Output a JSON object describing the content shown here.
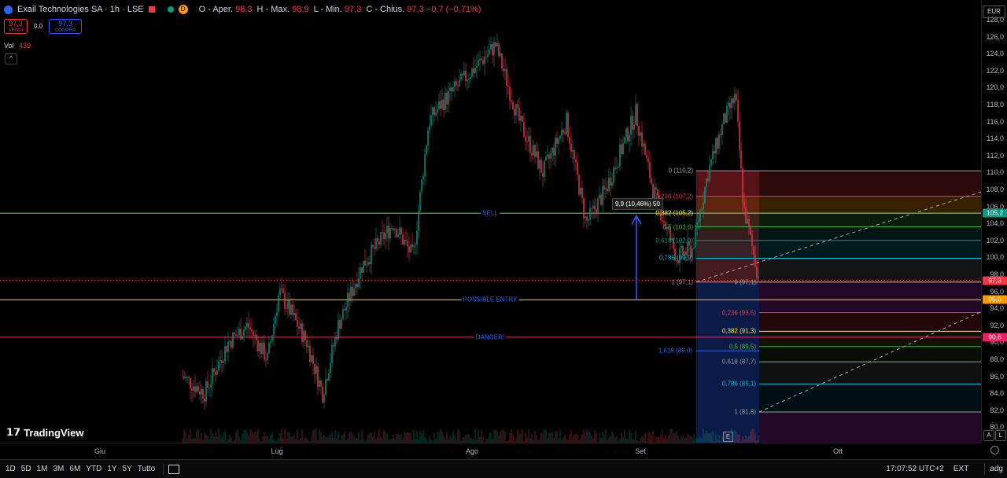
{
  "header": {
    "title": "Exail Technologies SA · 1h · LSE",
    "status_letter": "D",
    "ohlc": {
      "open_label": "O - Aper.",
      "open": "98,3",
      "high_label": "H - Max.",
      "high": "98,9",
      "low_label": "L - Min.",
      "low": "97,3",
      "close_label": "C - Chius.",
      "close": "97,3",
      "change": "−0,7 (−0,71%)"
    }
  },
  "trade": {
    "sell_price": "97,3",
    "sell_label": "VENDI",
    "spread": "0,0",
    "buy_price": "97,3",
    "buy_label": "COMPRA"
  },
  "volume": {
    "label": "Vol",
    "value": "439"
  },
  "collapse_icon": "^",
  "currency": "EUR",
  "price_axis": {
    "ticks": [
      "128,0",
      "126,0",
      "124,0",
      "122,0",
      "120,0",
      "118,0",
      "116,0",
      "114,0",
      "112,0",
      "110,0",
      "108,0",
      "106,0",
      "104,0",
      "102,0",
      "100,0",
      "98,0",
      "96,0",
      "94,0",
      "92,0",
      "90,0",
      "88,0",
      "86,0",
      "84,0",
      "82,0",
      "80,0"
    ],
    "tags": [
      {
        "text": "105,2",
        "color": "#089981"
      },
      {
        "text": "97,3",
        "color": "#f23645"
      },
      {
        "text": "95,0",
        "color": "#ff9800"
      },
      {
        "text": "90,6",
        "color": "#e91e63"
      }
    ]
  },
  "time_axis": [
    "Giu",
    "Lug",
    "Ago",
    "Set",
    "Ott"
  ],
  "horizontal_lines": [
    {
      "label": "SELL",
      "price": 105.2,
      "color": "#4caf50"
    },
    {
      "label": "POSSIBLE ENTRY",
      "price": 95.0,
      "color": "#ff9800"
    },
    {
      "label": "DANGER!",
      "price": 90.6,
      "color": "#e91e63"
    }
  ],
  "fib_upper": [
    {
      "text": "0 (110,2)",
      "price": 110.2,
      "color": "#9e9e9e"
    },
    {
      "text": "0,236 (107,2)",
      "price": 107.2,
      "color": "#f23645"
    },
    {
      "text": "0,382 (105,2)",
      "price": 105.2,
      "color": "#ffeb3b"
    },
    {
      "text": "0,5 (103,6)",
      "price": 103.6,
      "color": "#4caf50"
    },
    {
      "text": "0,618 (102,0)",
      "price": 102.0,
      "color": "#089981"
    },
    {
      "text": "0,786 (99,9)",
      "price": 99.9,
      "color": "#00bcd4"
    },
    {
      "text": "1 (97,1)",
      "price": 97.1,
      "color": "#9e9e9e"
    }
  ],
  "fib_lower": [
    {
      "text": "0 (97,1)",
      "price": 97.1,
      "color": "#9e9e9e"
    },
    {
      "text": "0,236 (93,5)",
      "price": 93.5,
      "color": "#f23645"
    },
    {
      "text": "0,382 (91,3)",
      "price": 91.3,
      "color": "#ffeb3b"
    },
    {
      "text": "0,5 (89,5)",
      "price": 89.5,
      "color": "#4caf50"
    },
    {
      "text": "0,618 (87,7)",
      "price": 87.7,
      "color": "#9e9e9e"
    },
    {
      "text": "0,786 (85,1)",
      "price": 85.1,
      "color": "#00bcd4"
    },
    {
      "text": "1 (81,8)",
      "price": 81.8,
      "color": "#9e9e9e"
    }
  ],
  "fib_extension": {
    "text": "1,618 (89,0)",
    "price": 89.0,
    "color": "#2962ff"
  },
  "measure_tooltip": "9,9 (10,46%) 50",
  "event_marker": "E",
  "brand": "TradingView",
  "bottom_bar": {
    "ranges": [
      "1D",
      "5D",
      "1M",
      "3M",
      "6M",
      "YTD",
      "1Y",
      "5Y",
      "Tutto"
    ],
    "time": "17:07:52 UTC+2",
    "ext": "EXT",
    "adj": "adg"
  },
  "axis_buttons": [
    "A",
    "L"
  ],
  "chart_data": {
    "type": "candlestick",
    "price_range": [
      79,
      129
    ],
    "series": [
      {
        "name": "Exail Technologies SA",
        "approx_close_path": [
          {
            "x": "Giu",
            "y": 86
          },
          {
            "x": "mid-Giu",
            "y": 88
          },
          {
            "x": "late-Giu",
            "y": 91
          },
          {
            "x": "Lug",
            "y": 88
          },
          {
            "x": "mid-Lug",
            "y": 94
          },
          {
            "x": "late-Lug",
            "y": 104
          },
          {
            "x": "early-Ago",
            "y": 118
          },
          {
            "x": "Ago",
            "y": 125
          },
          {
            "x": "mid-Ago",
            "y": 118
          },
          {
            "x": "late-Ago",
            "y": 110
          },
          {
            "x": "Set",
            "y": 118
          },
          {
            "x": "mid-Set",
            "y": 101
          },
          {
            "x": "late-Set",
            "y": 119
          },
          {
            "x": "end",
            "y": 97.3
          }
        ]
      }
    ]
  }
}
